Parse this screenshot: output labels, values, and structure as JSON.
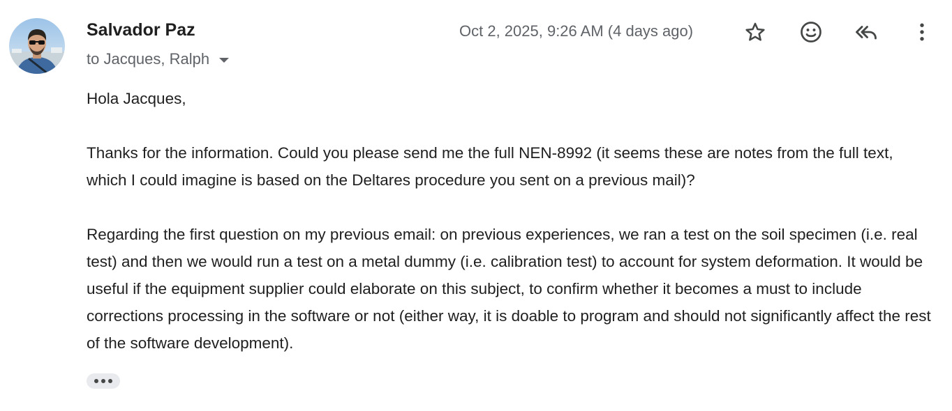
{
  "message": {
    "sender_name": "Salvador Paz",
    "recipients": "to Jacques, Ralph",
    "date": "Oct 2, 2025, 9:26 AM (4 days ago)",
    "greeting": "Hola Jacques,",
    "paragraphs": [
      "Thanks for the information. Could you please send me the full NEN-8992 (it seems these are notes from the full text, which I could imagine is based on the Deltares procedure you sent on a previous mail)?",
      "Regarding the first question on my previous email: on previous experiences, we ran a test on the soil specimen (i.e. real test) and then we would run a test on a metal dummy (i.e. calibration test) to account for system deformation. It would be useful if the equipment supplier could elaborate on this subject, to confirm whether it becomes a must to include corrections processing in the software or not (either way, it is doable to program and should not significantly affect the rest of the software development)."
    ]
  },
  "icons": {
    "star": "star-icon",
    "emoji": "emoji-icon",
    "reply_all": "reply-all-icon",
    "more": "more-vert-icon",
    "dropdown": "caret-down-icon",
    "ellipsis": "show-trimmed-content-icon"
  },
  "colors": {
    "text_primary": "#1f1f1f",
    "text_secondary": "#5f6368",
    "icon": "#444746",
    "ellipsis_bg": "#e8eaed"
  }
}
